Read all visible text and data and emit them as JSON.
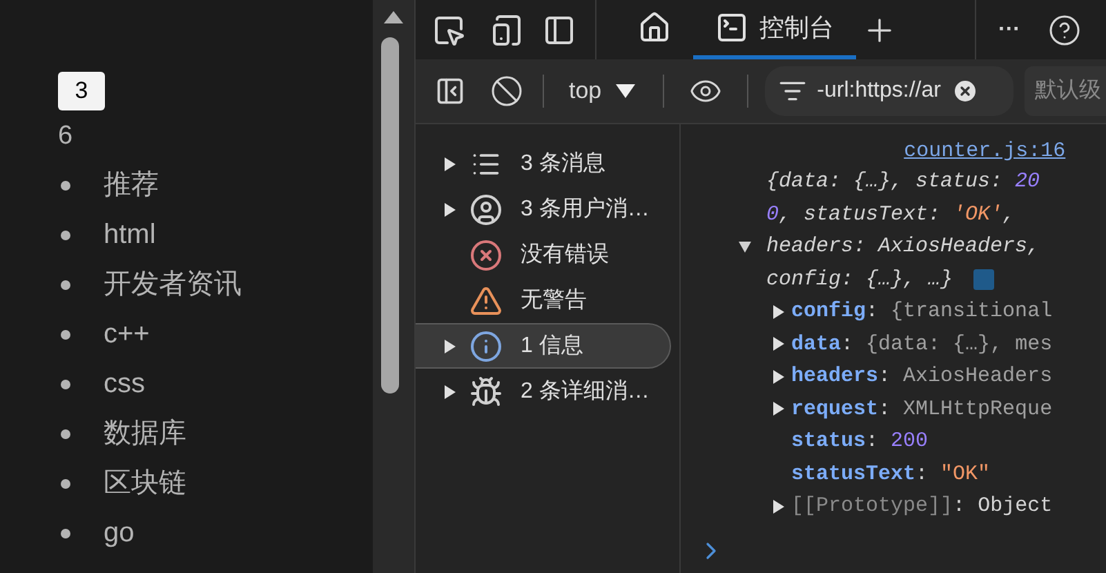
{
  "page": {
    "button": "3",
    "count": "6",
    "list": [
      "推荐",
      "html",
      "开发者资讯",
      "c++",
      "css",
      "数据库",
      "区块链",
      "go"
    ]
  },
  "toolbar": {
    "tabs": [
      {
        "kind": "home",
        "selected": false
      },
      {
        "kind": "console",
        "label": "控制台",
        "selected": true
      }
    ],
    "more": "···"
  },
  "console_toolbar": {
    "context": "top",
    "filter": {
      "value": "-url:https://ar"
    },
    "levels": "默认级"
  },
  "sidebar": {
    "items": [
      {
        "kind": "messages",
        "label": "3 条消息",
        "expandable": true,
        "selected": false
      },
      {
        "kind": "user",
        "label": "3 条用户消…",
        "expandable": true,
        "selected": false
      },
      {
        "kind": "error",
        "label": "没有错误",
        "expandable": false,
        "selected": false
      },
      {
        "kind": "warning",
        "label": "无警告",
        "expandable": false,
        "selected": false
      },
      {
        "kind": "info",
        "label": "1 信息",
        "expandable": true,
        "selected": true
      },
      {
        "kind": "verbose",
        "label": "2 条详细消…",
        "expandable": true,
        "selected": false
      }
    ]
  },
  "console": {
    "source": "counter.js:16",
    "expanded": true,
    "summary": [
      {
        "kind": "plain",
        "text": "{data: {…}, status: "
      },
      {
        "kind": "number",
        "text": "200"
      },
      {
        "kind": "plain",
        "text": ", statusText: "
      },
      {
        "kind": "string",
        "text": "'OK'"
      },
      {
        "kind": "plain",
        "text": ", headers: AxiosHeaders, config: {…}, …}"
      }
    ],
    "properties": [
      {
        "key": "config",
        "sep": ":",
        "value": "{transitional",
        "kind": "object",
        "expandable": true
      },
      {
        "key": "data",
        "sep": ":",
        "value": "{data: {…}, mes",
        "kind": "object",
        "expandable": true
      },
      {
        "key": "headers",
        "sep": ":",
        "value": "AxiosHeaders",
        "kind": "object",
        "expandable": true
      },
      {
        "key": "request",
        "sep": ":",
        "value": "XMLHttpReque",
        "kind": "object",
        "expandable": true
      },
      {
        "key": "status",
        "sep": ":",
        "value": "200",
        "kind": "number",
        "expandable": false
      },
      {
        "key": "statusText",
        "sep": ":",
        "value": "\"OK\"",
        "kind": "string",
        "expandable": false
      },
      {
        "key": "[[Prototype]]",
        "sep": ":",
        "value": "Object",
        "kind": "proto",
        "expandable": true
      }
    ]
  }
}
